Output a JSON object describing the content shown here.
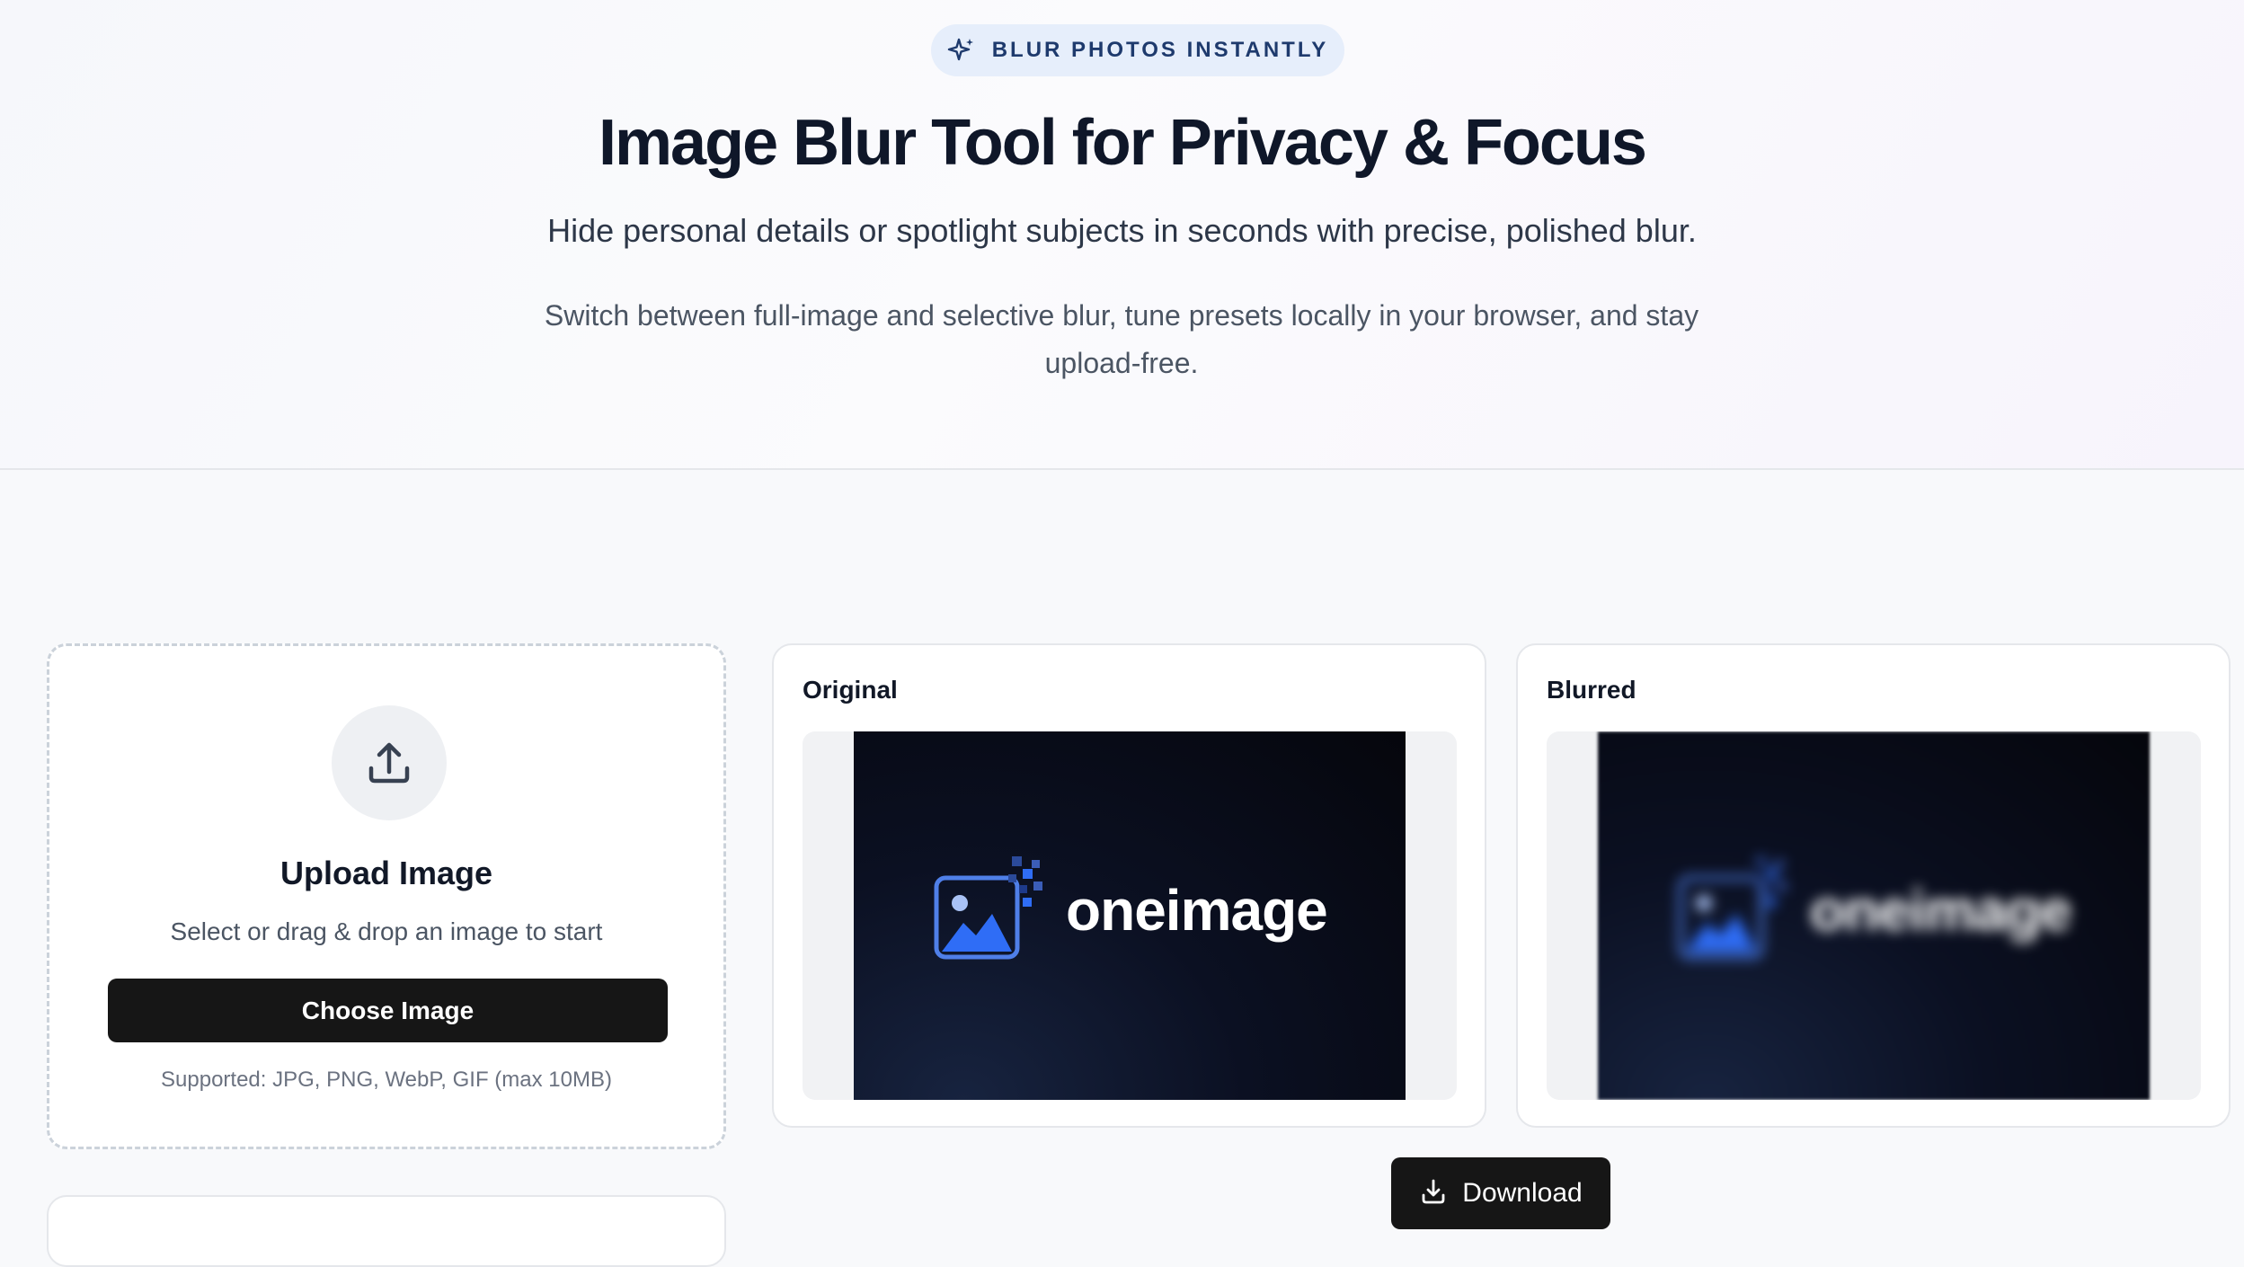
{
  "hero": {
    "badge_text": "BLUR PHOTOS INSTANTLY",
    "badge_icon": "sparkle-icon",
    "title": "Image Blur Tool for Privacy & Focus",
    "subtitle": "Hide personal details or spotlight subjects in seconds with precise, polished blur.",
    "description": "Switch between full-image and selective blur, tune presets locally in your browser, and stay upload-free."
  },
  "upload": {
    "icon": "upload-icon",
    "title": "Upload Image",
    "subtitle": "Select or drag & drop an image to start",
    "button_label": "Choose Image",
    "supported": "Supported: JPG, PNG, WebP, GIF (max 10MB)"
  },
  "preview": {
    "original_label": "Original",
    "blurred_label": "Blurred",
    "image_text": "oneimage"
  },
  "download": {
    "label": "Download",
    "icon": "download-icon"
  },
  "colors": {
    "accent_dark": "#161616",
    "badge_bg": "#e6eefb",
    "badge_text": "#1e3a6d",
    "logo_blue": "#2f6df6"
  }
}
